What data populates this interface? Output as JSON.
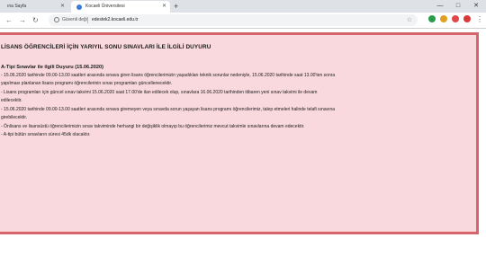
{
  "browser": {
    "tabs": [
      {
        "label": "ına Sayfa"
      },
      {
        "label": "Kocaeli Üniversitesi"
      }
    ],
    "new_tab": "+",
    "window_controls": {
      "minimize": "—",
      "maximize": "□",
      "close": "✕"
    },
    "nav": {
      "back": "←",
      "forward": "→",
      "reload": "↻"
    },
    "security_label": "Güvenli değil",
    "url": "edestek2.kocaeli.edu.tr",
    "extension_colors": [
      "#2a9d4a",
      "#e0a020",
      "#e04848",
      "#d83a3a"
    ]
  },
  "notice": {
    "title": "LİSANS ÖĞRENCİLERİ İÇİN YARIYIL SONU SINAVLARI İLE İLGİLİ DUYURU",
    "subtitle": "A-Tipi Sınavlar ile ilgili Duyuru (15.06.2020)",
    "lines": [
      "- 15.06.2020 tarihinde 09.00-13.00 saatleri arasında sınava giren lisans öğrencilerimizin yaşadıkları teknik sorunlar nedeniyle, 15.06.2020 tarihinde saat 13.00'ten sonra",
      "yapılması planlanan lisans programı öğrencilerinin sınav programları güncellenecektir.",
      "- Lisans programları için güncel sınav takvimi 15.06.2020 saat 17.00'de ilan edilecek olup, sınavlara 16.06.2020 tarihinden itibaren yeni sınav takvimi ile devam",
      "edilecektir.",
      "- 15.06.2020 tarihinde 09.00-13.00 saatleri arasında sınava giremeyen veya sınavda sorun yaşayan lisans programı öğrencilerimiz, talep etmeleri halinde telafi sınavına",
      "girebilecektir.",
      "- Önlisans ve lisansüstü öğrencilerimizin sınav takviminde herhangi bir değişiklik olmayıp bu öğrencilerimiz mevcut takvimle sınavlarına devam edecektir.",
      "- A-tipi bütün sınavların süresi 45dk olacaktır."
    ]
  }
}
